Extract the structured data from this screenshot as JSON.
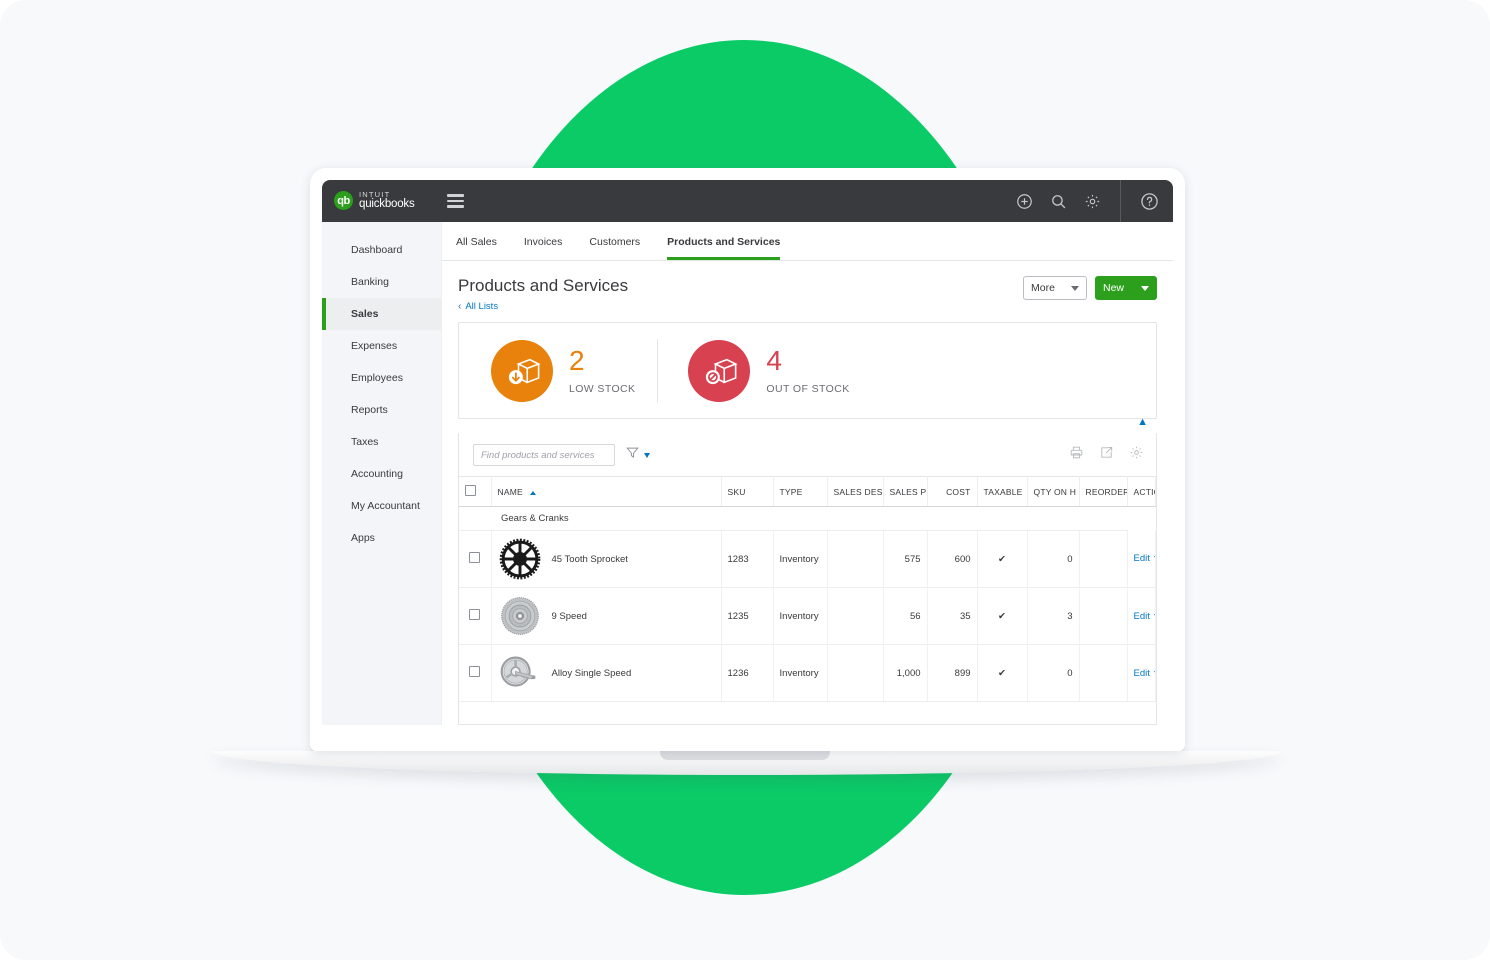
{
  "topbar": {
    "logo_mark": "qb",
    "logo_intuit": "intuit",
    "logo_name": "quickbooks",
    "menu_icon": "hamburger-menu-icon",
    "icons": [
      "plus-circle-icon",
      "search-icon",
      "gear-icon",
      "help-circle-icon"
    ]
  },
  "sidebar": {
    "items": [
      {
        "label": "Dashboard",
        "active": false
      },
      {
        "label": "Banking",
        "active": false
      },
      {
        "label": "Sales",
        "active": true
      },
      {
        "label": "Expenses",
        "active": false
      },
      {
        "label": "Employees",
        "active": false
      },
      {
        "label": "Reports",
        "active": false
      },
      {
        "label": "Taxes",
        "active": false
      },
      {
        "label": "Accounting",
        "active": false
      },
      {
        "label": "My Accountant",
        "active": false
      },
      {
        "label": "Apps",
        "active": false
      }
    ]
  },
  "tabs": [
    {
      "label": "All Sales",
      "active": false
    },
    {
      "label": "Invoices",
      "active": false
    },
    {
      "label": "Customers",
      "active": false
    },
    {
      "label": "Products and Services",
      "active": true
    }
  ],
  "page": {
    "title": "Products and Services",
    "breadcrumb_chevron": "‹",
    "breadcrumb_label": "All Lists",
    "more_label": "More",
    "new_label": "New",
    "accent_green": "#2ca01c",
    "link_blue": "#0077c5"
  },
  "stock_cards": [
    {
      "count": "2",
      "label": "LOW STOCK",
      "color": "#e8820c",
      "icon": "box-arrow-down-icon"
    },
    {
      "count": "4",
      "label": "OUT OF STOCK",
      "color": "#d8414f",
      "icon": "box-no-entry-icon"
    }
  ],
  "table_toolbar": {
    "search_placeholder": "Find products and services",
    "search_value": "",
    "filter_icon": "funnel-filter-icon",
    "print_icon": "printer-icon",
    "export_icon": "export-icon",
    "settings_icon": "gear-icon"
  },
  "table": {
    "columns": [
      "NAME",
      "SKU",
      "TYPE",
      "SALES DES",
      "SALES PRIC",
      "COST",
      "TAXABLE",
      "QTY ON H",
      "REORDER",
      "ACTION"
    ],
    "sorted_column": "NAME",
    "sort_direction": "asc",
    "group_label": "Gears & Cranks",
    "rows": [
      {
        "image": "sprocket-wheel-image",
        "name": "45 Tooth Sprocket",
        "sku": "1283",
        "type": "Inventory",
        "sales_description": "",
        "sales_price": "575",
        "cost": "600",
        "taxable": "✔",
        "qty_on_hand": "0",
        "qty_low": true,
        "reorder_point": "",
        "action": "Edit"
      },
      {
        "image": "cassette-image",
        "name": "9 Speed",
        "sku": "1235",
        "type": "Inventory",
        "sales_description": "",
        "sales_price": "56",
        "cost": "35",
        "taxable": "✔",
        "qty_on_hand": "3",
        "qty_low": true,
        "reorder_point": "",
        "action": "Edit"
      },
      {
        "image": "crankset-image",
        "name": "Alloy Single Speed",
        "sku": "1236",
        "type": "Inventory",
        "sales_description": "",
        "sales_price": "1,000",
        "cost": "899",
        "taxable": "✔",
        "qty_on_hand": "0",
        "qty_low": true,
        "reorder_point": "",
        "action": "Edit"
      }
    ]
  }
}
